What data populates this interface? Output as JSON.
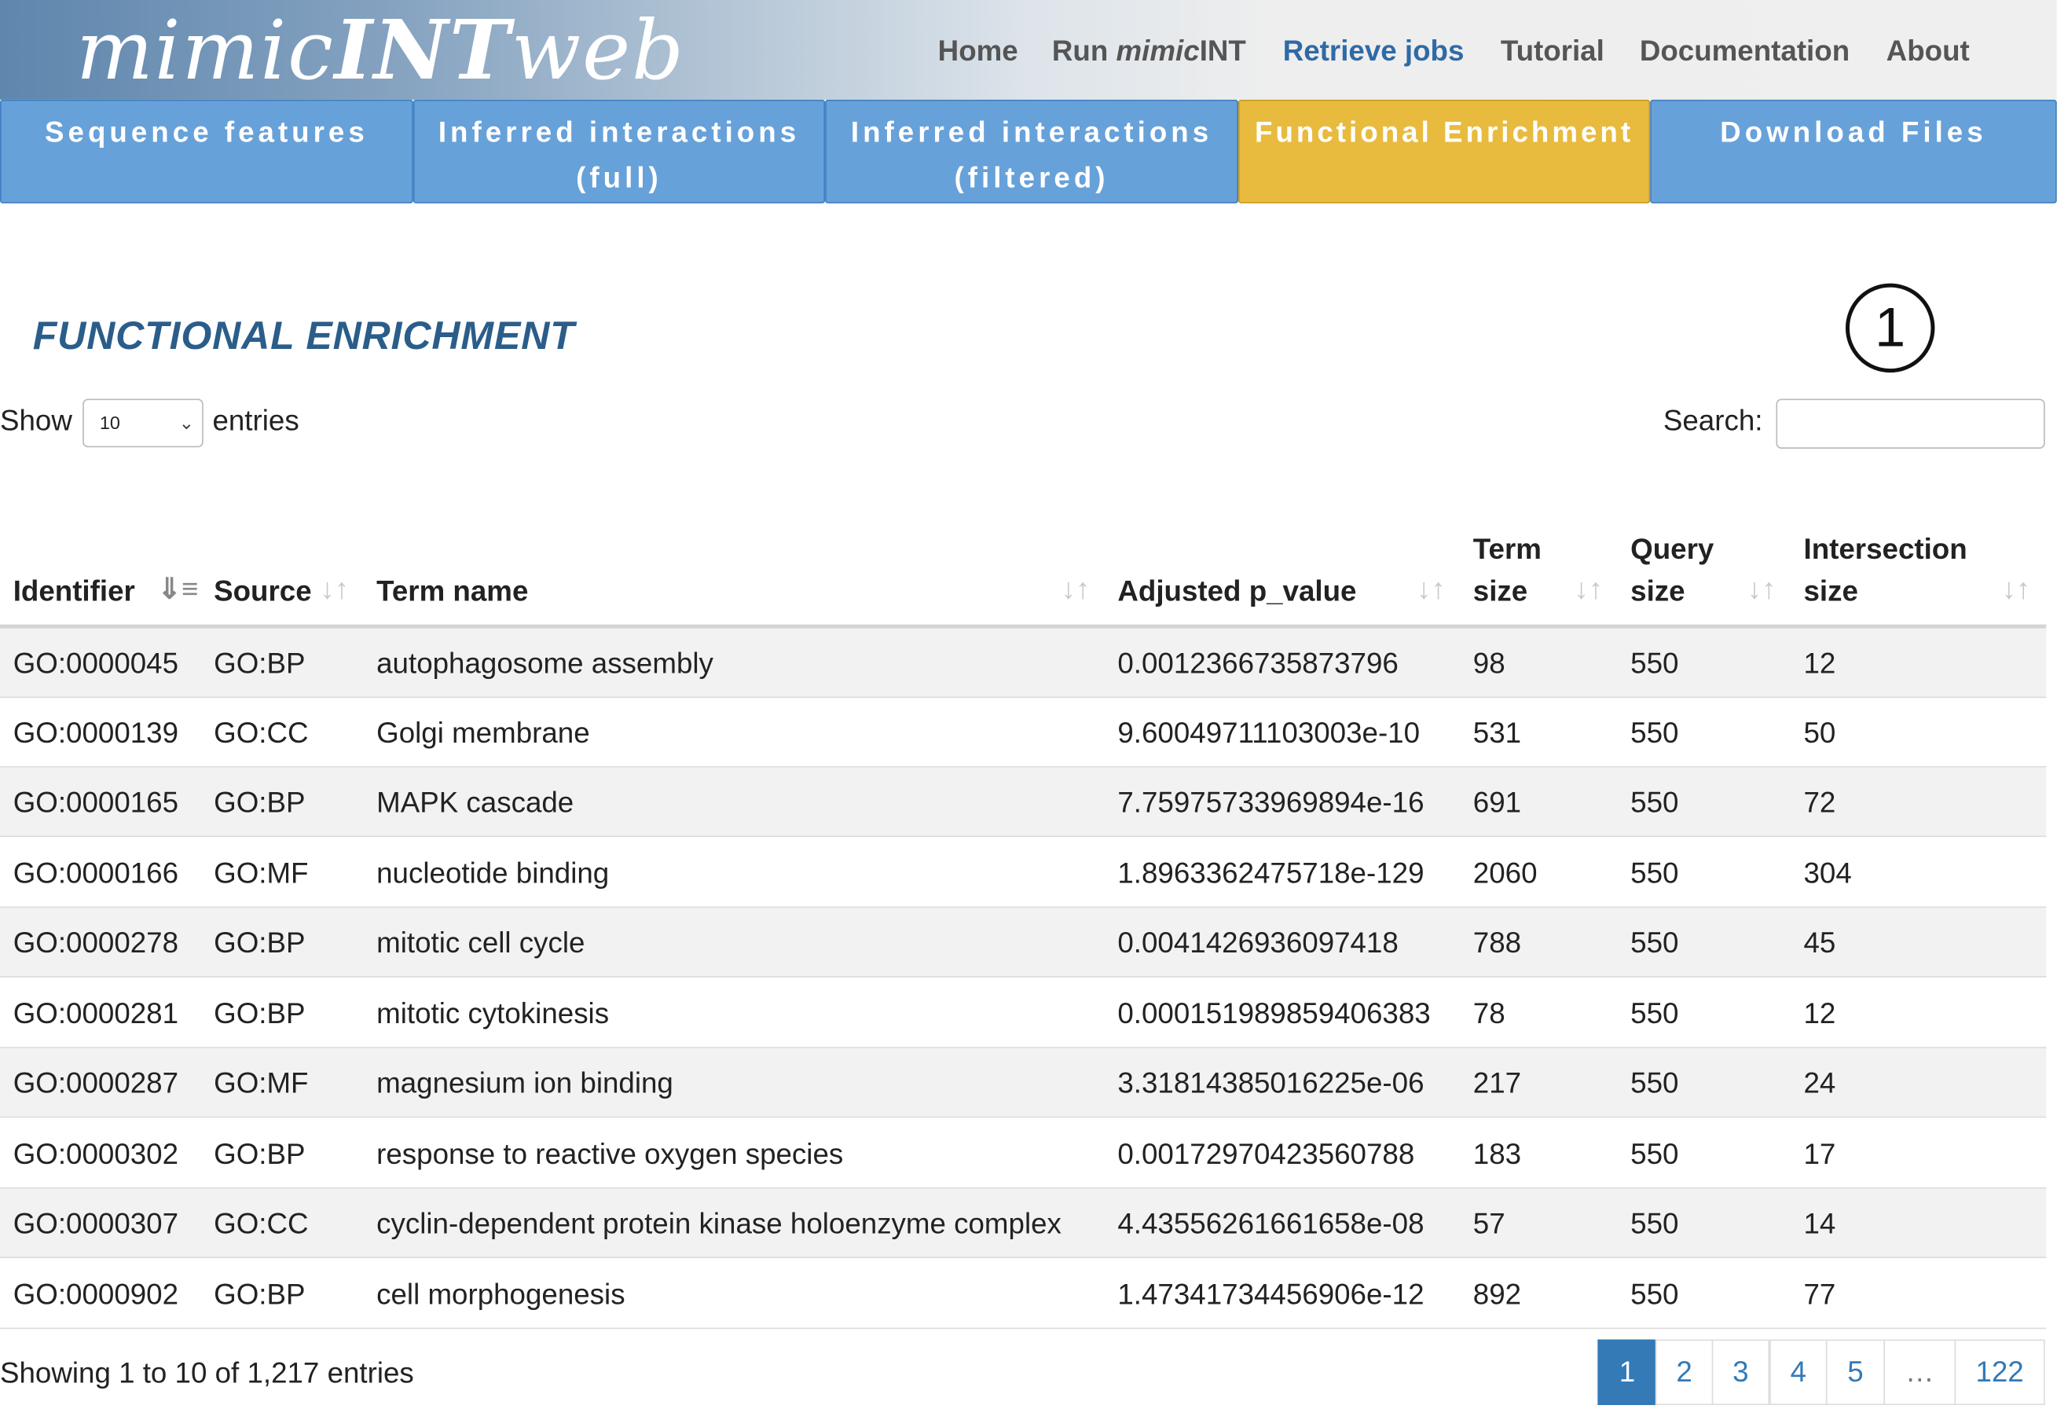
{
  "app": {
    "logo_prefix": "mimic",
    "logo_bold": "INT",
    "logo_suffix": "web"
  },
  "nav": {
    "home": "Home",
    "run_prefix": "Run ",
    "run_italic": "mimic",
    "run_suffix": "INT",
    "retrieve": "Retrieve jobs",
    "tutorial": "Tutorial",
    "documentation": "Documentation",
    "about": "About",
    "active_color": "#2f6aa5"
  },
  "tabs": {
    "sequence_features": "Sequence features",
    "inferred_full_l1": "Inferred interactions",
    "inferred_full_l2": "(full)",
    "inferred_filtered_l1": "Inferred interactions",
    "inferred_filtered_l2": "(filtered)",
    "functional_enrichment": "Functional Enrichment",
    "download": "Download Files",
    "active_color": "#e8bb3e",
    "inactive_color": "#67a1d9"
  },
  "section": {
    "title": "FUNCTIONAL ENRICHMENT",
    "marker": "1"
  },
  "controls": {
    "show_label": "Show",
    "page_length": "10",
    "entries_label": "entries",
    "search_label": "Search:",
    "search_value": ""
  },
  "table": {
    "headers": {
      "identifier": "Identifier",
      "source": "Source",
      "term_name": "Term name",
      "adjusted_p": "Adjusted p_value",
      "term_size_1": "Term",
      "term_size_2": "size",
      "query_size_1": "Query",
      "query_size_2": "size",
      "intersection_1": "Intersection",
      "intersection_2": "size"
    },
    "sort_icon": "sort-arrows-icon",
    "rows": [
      {
        "id": "GO:0000045",
        "source": "GO:BP",
        "term": "autophagosome assembly",
        "p": "0.0012366735873796",
        "term_size": "98",
        "query_size": "550",
        "intersection": "12"
      },
      {
        "id": "GO:0000139",
        "source": "GO:CC",
        "term": "Golgi membrane",
        "p": "9.60049711103003e-10",
        "term_size": "531",
        "query_size": "550",
        "intersection": "50"
      },
      {
        "id": "GO:0000165",
        "source": "GO:BP",
        "term": "MAPK cascade",
        "p": "7.75975733969894e-16",
        "term_size": "691",
        "query_size": "550",
        "intersection": "72"
      },
      {
        "id": "GO:0000166",
        "source": "GO:MF",
        "term": "nucleotide binding",
        "p": "1.8963362475718e-129",
        "term_size": "2060",
        "query_size": "550",
        "intersection": "304"
      },
      {
        "id": "GO:0000278",
        "source": "GO:BP",
        "term": "mitotic cell cycle",
        "p": "0.0041426936097418",
        "term_size": "788",
        "query_size": "550",
        "intersection": "45"
      },
      {
        "id": "GO:0000281",
        "source": "GO:BP",
        "term": "mitotic cytokinesis",
        "p": "0.000151989859406383",
        "term_size": "78",
        "query_size": "550",
        "intersection": "12"
      },
      {
        "id": "GO:0000287",
        "source": "GO:MF",
        "term": "magnesium ion binding",
        "p": "3.31814385016225e-06",
        "term_size": "217",
        "query_size": "550",
        "intersection": "24"
      },
      {
        "id": "GO:0000302",
        "source": "GO:BP",
        "term": "response to reactive oxygen species",
        "p": "0.00172970423560788",
        "term_size": "183",
        "query_size": "550",
        "intersection": "17"
      },
      {
        "id": "GO:0000307",
        "source": "GO:CC",
        "term": "cyclin-dependent protein kinase holoenzyme complex",
        "p": "4.43556261661658e-08",
        "term_size": "57",
        "query_size": "550",
        "intersection": "14"
      },
      {
        "id": "GO:0000902",
        "source": "GO:BP",
        "term": "cell morphogenesis",
        "p": "1.47341734456906e-12",
        "term_size": "892",
        "query_size": "550",
        "intersection": "77"
      }
    ]
  },
  "footer": {
    "info": "Showing 1 to 10 of 1,217 entries",
    "pages": [
      "1",
      "2",
      "3",
      "4",
      "5",
      "…",
      "122"
    ],
    "active_page": "1"
  }
}
